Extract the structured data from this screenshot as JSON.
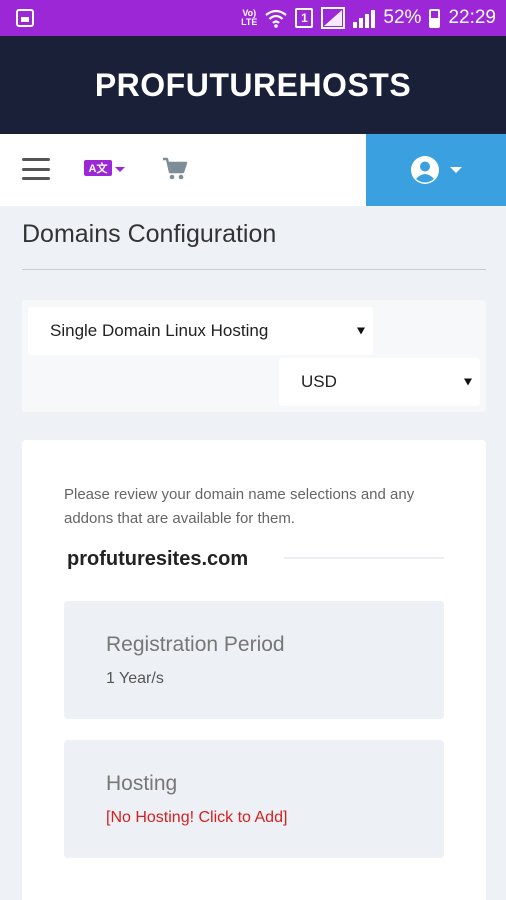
{
  "status_bar": {
    "volte": "Vo)) LTE",
    "sim": "1",
    "battery": "52%",
    "time": "22:29"
  },
  "brand": {
    "title": "PROFUTUREHOSTS"
  },
  "nav": {
    "language_icon_text": "A文",
    "icons": [
      "menu-icon",
      "translate-icon",
      "cart-icon",
      "account-icon"
    ],
    "account_bg": "#3aa0e0"
  },
  "page": {
    "title": "Domains Configuration"
  },
  "selects": {
    "product": "Single Domain Linux Hosting",
    "currency": "USD"
  },
  "card": {
    "review_text": "Please review your domain name selections and any addons that are available for them.",
    "domain": "profuturesites.com",
    "options": [
      {
        "label": "Registration Period",
        "value": "1 Year/s"
      },
      {
        "label": "Hosting",
        "value": "[No Hosting! Click to Add]"
      }
    ]
  },
  "colors": {
    "status_bar": "#9b27d6",
    "header": "#1a2038",
    "accent_blue": "#3aa0e0",
    "warning_red": "#d22222"
  }
}
